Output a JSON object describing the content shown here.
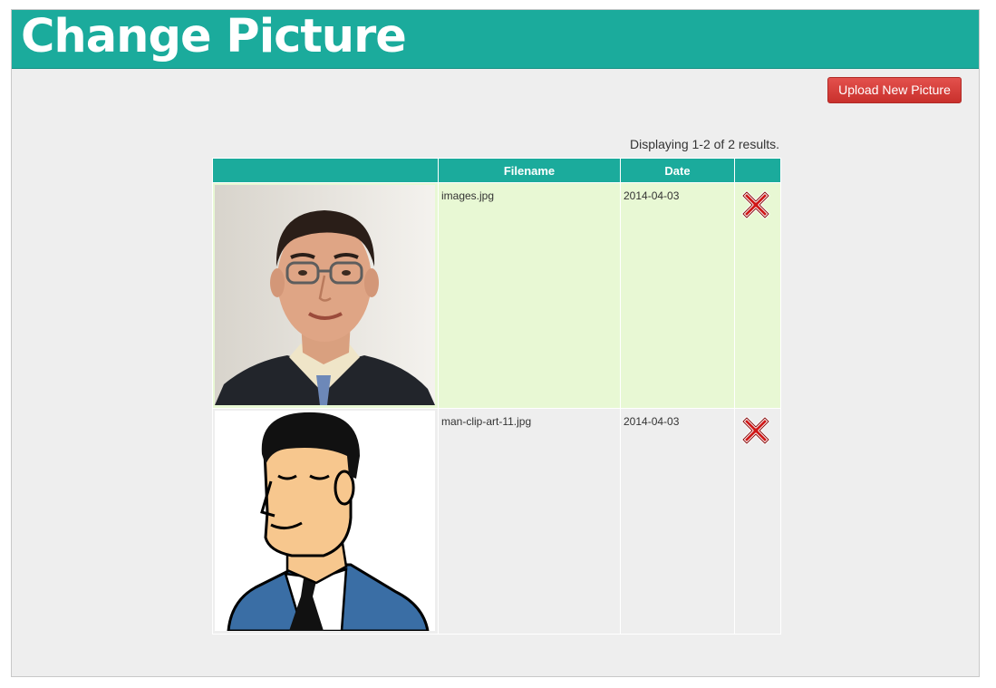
{
  "page": {
    "title": "Change Picture"
  },
  "toolbar": {
    "upload_label": "Upload New Picture"
  },
  "grid": {
    "summary": "Displaying 1-2 of 2 results.",
    "columns": [
      "",
      "Filename",
      "Date",
      ""
    ],
    "rows": [
      {
        "image": "photo-portrait-image",
        "filename": "images.jpg",
        "date": "2014-04-03",
        "delete_icon": "red-x-delete-icon"
      },
      {
        "image": "cartoon-man-image",
        "filename": "man-clip-art-11.jpg",
        "date": "2014-04-03",
        "delete_icon": "red-x-delete-icon"
      }
    ]
  },
  "colors": {
    "header_bg": "#1bab9c",
    "button_bg": "#d9534f",
    "row_odd_bg": "#e8f8d4",
    "row_even_bg": "#eeeeee",
    "page_bg": "#eeeeee"
  }
}
